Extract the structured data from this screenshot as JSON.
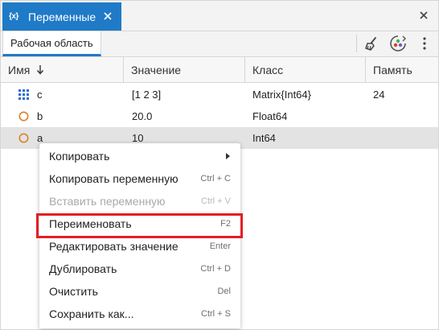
{
  "panel": {
    "tab_icon": "{x}",
    "tab_title": "Переменные",
    "icons": {
      "tab_close": "close-icon",
      "panel_close": "close-icon"
    }
  },
  "toolbar": {
    "workspace_tab": "Рабочая область",
    "icons": [
      "broom-icon",
      "workspace-browser-icon",
      "more-vertical-icon"
    ]
  },
  "table": {
    "columns": [
      "Имя",
      "Значение",
      "Класс",
      "Память"
    ],
    "sort_indicator": "arrow-down-icon",
    "rows": [
      {
        "icon": "matrix-icon",
        "name": "c",
        "value": "[1 2 3]",
        "class": "Matrix{Int64}",
        "memory": "24"
      },
      {
        "icon": "scalar-circle-icon",
        "name": "b",
        "value": "20.0",
        "class": "Float64",
        "memory": ""
      },
      {
        "icon": "scalar-circle-icon",
        "name": "a",
        "value": "10",
        "class": "Int64",
        "memory": ""
      }
    ],
    "selected_row": "a"
  },
  "context_menu": {
    "items": [
      {
        "label": "Копировать",
        "shortcut": "",
        "submenu": true,
        "disabled": false
      },
      {
        "label": "Копировать переменную",
        "shortcut": "Ctrl + C",
        "submenu": false,
        "disabled": false
      },
      {
        "label": "Вставить переменную",
        "shortcut": "Ctrl + V",
        "submenu": false,
        "disabled": true
      },
      {
        "label": "Переименовать",
        "shortcut": "F2",
        "submenu": false,
        "disabled": false
      },
      {
        "label": "Редактировать значение",
        "shortcut": "Enter",
        "submenu": false,
        "disabled": false
      },
      {
        "label": "Дублировать",
        "shortcut": "Ctrl + D",
        "submenu": false,
        "disabled": false
      },
      {
        "label": "Очистить",
        "shortcut": "Del",
        "submenu": false,
        "disabled": false
      },
      {
        "label": "Сохранить как...",
        "shortcut": "Ctrl + S",
        "submenu": false,
        "disabled": false
      }
    ],
    "highlighted_item": "Переименовать"
  },
  "colors": {
    "accent": "#1f7ac7",
    "highlight_border": "#e31e25",
    "scalar_icon": "#d9822b",
    "matrix_icon": "#2a6fd1",
    "selected_row": "#e3e3e3"
  }
}
